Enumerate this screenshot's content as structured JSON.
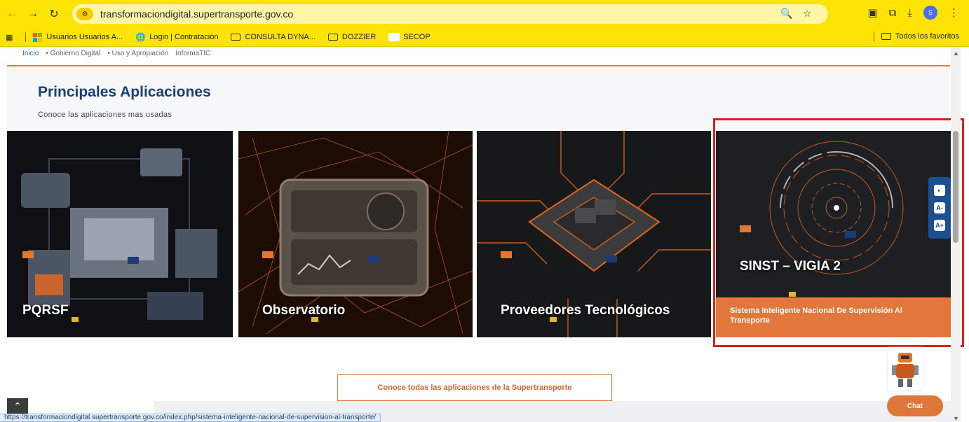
{
  "browser": {
    "url": "transformaciondigital.supertransporte.gov.co",
    "bookmarks": [
      {
        "label": "Usuarios Usuarios A...",
        "icon": "microsoft-icon"
      },
      {
        "label": "Login | Contratación",
        "icon": "globe-icon"
      },
      {
        "label": "CONSULTA DYNA...",
        "icon": "folder-icon"
      },
      {
        "label": "DOZZIER",
        "icon": "folder-icon"
      },
      {
        "label": "SECOP",
        "icon": "page-icon"
      }
    ],
    "all_bookmarks_label": "Todos los favoritos",
    "profile_initial": "S",
    "status_url": "https://transformaciondigital.supertransporte.gov.co/index.php/sistema-inteligente-nacional-de-supervision-al-transporte/"
  },
  "breadcrumb": [
    "Inicio",
    "• Gobierno Digital",
    "• Uso y Apropiación",
    "InformaTIC"
  ],
  "section": {
    "title": "Principales Aplicaciones",
    "subtitle": "Conoce las aplicaciones mas usadas"
  },
  "cards": [
    {
      "title": "PQRSF"
    },
    {
      "title": "Observatorio"
    },
    {
      "title": "Proveedores Tecnológicos"
    },
    {
      "title": "SINST – VIGIA 2",
      "description": "Sistema Inteligente Nacional De Supervisión Al Transporte"
    }
  ],
  "cta_label": "Conoce todas las aplicaciones de la Supertransporte",
  "chat_label": "Chat",
  "accessibility": [
    "contrast-icon",
    "text-decrease-icon",
    "text-increase-icon"
  ],
  "colors": {
    "accent": "#e1773a",
    "brand_blue": "#1a3f75",
    "highlight": "#e21c1c",
    "chrome": "#fde404"
  }
}
